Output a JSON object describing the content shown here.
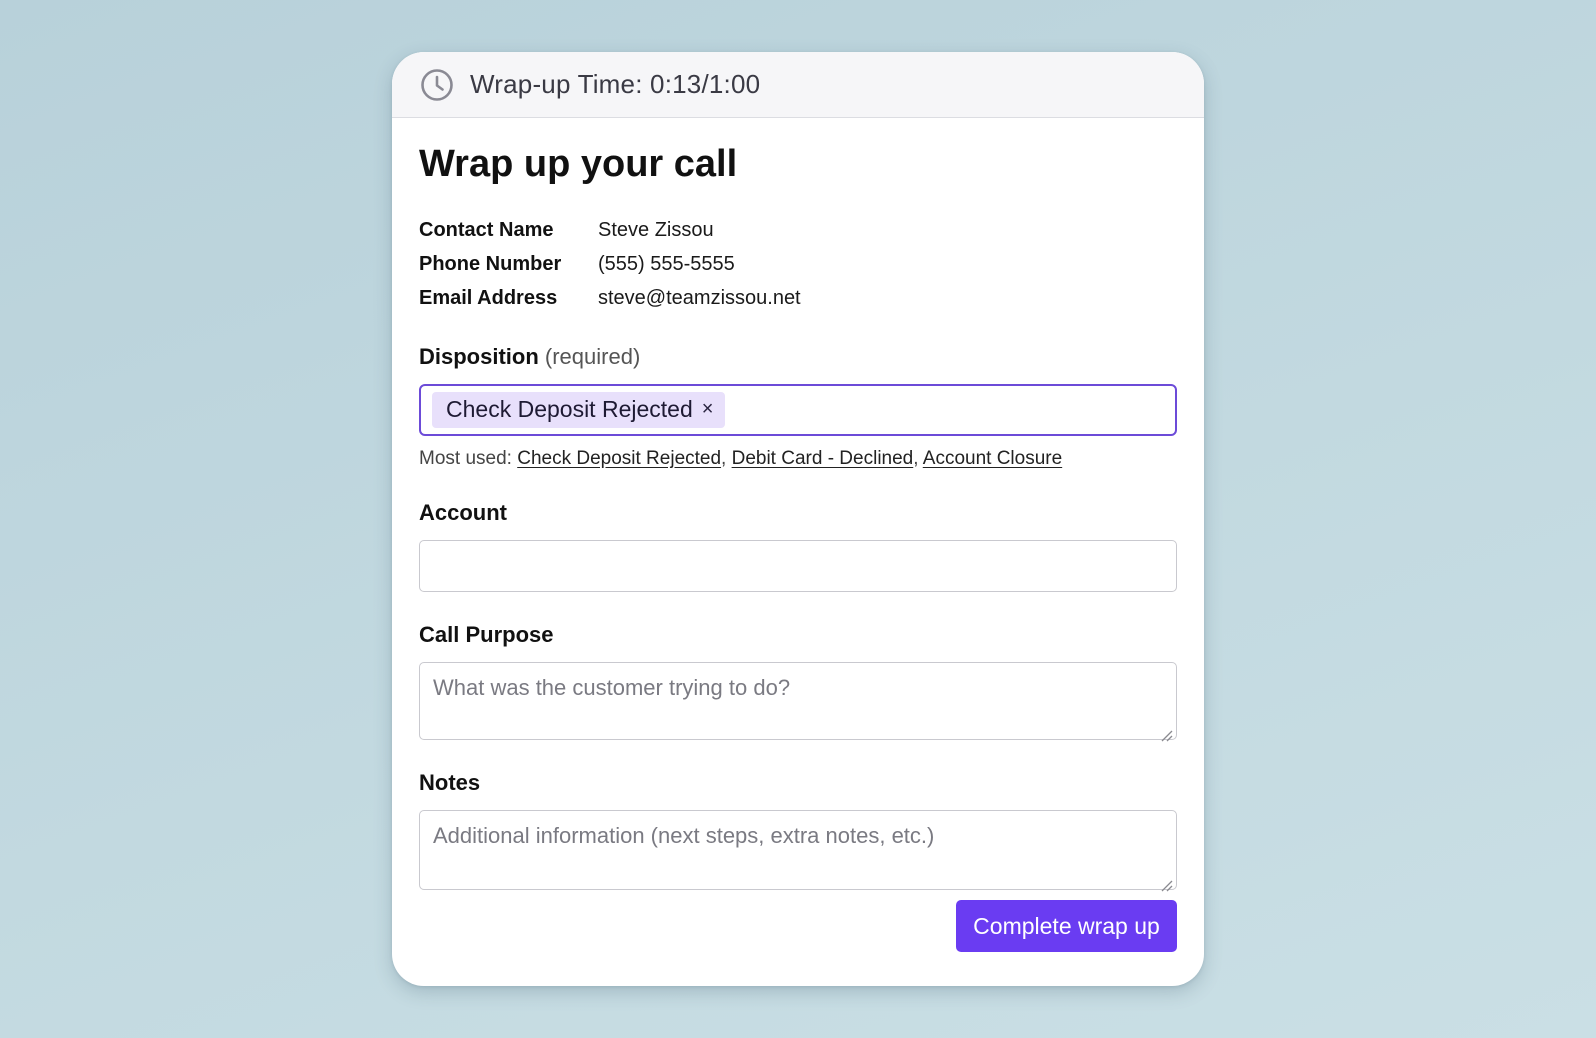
{
  "header": {
    "timer_label": "Wrap-up Time: 0:13/1:00",
    "icon": "clock-icon"
  },
  "form": {
    "title": "Wrap up your call",
    "contact": [
      {
        "label": "Contact Name",
        "value": "Steve Zissou"
      },
      {
        "label": "Phone Number",
        "value": "(555) 555-5555"
      },
      {
        "label": "Email Address",
        "value": "steve@teamzissou.net"
      }
    ],
    "disposition": {
      "label": "Disposition",
      "required_note": "(required)",
      "selected": "Check Deposit Rejected",
      "remove_glyph": "×",
      "most_used_prefix": "Most used:",
      "most_used": [
        "Check Deposit Rejected",
        "Debit Card - Declined",
        "Account Closure"
      ]
    },
    "account": {
      "label": "Account",
      "value": ""
    },
    "call_purpose": {
      "label": "Call Purpose",
      "placeholder": "What was the customer trying to do?"
    },
    "notes": {
      "label": "Notes",
      "placeholder": "Additional information (next steps, extra notes, etc.)"
    },
    "submit_label": "Complete wrap up"
  },
  "colors": {
    "accent": "#6a3cf2",
    "chip_bg": "#e8e0fb",
    "focus_border": "#6c4bd8",
    "background": "#bfd6de"
  }
}
